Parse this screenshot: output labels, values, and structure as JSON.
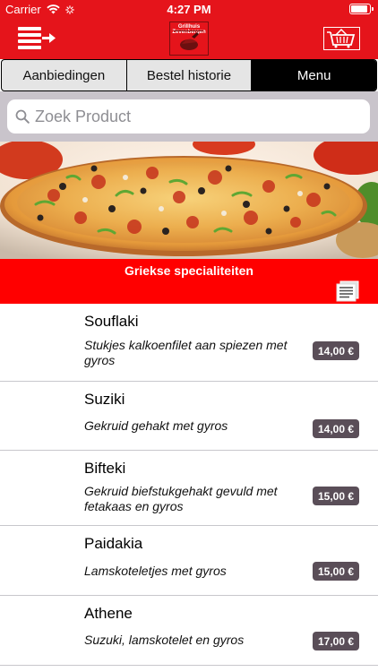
{
  "status_bar": {
    "carrier": "Carrier",
    "time": "4:27 PM",
    "battery_level": 1.0
  },
  "nav": {
    "logo_text": "Grillhuis Zevenbergen"
  },
  "tabs": [
    {
      "label": "Aanbiedingen",
      "active": false
    },
    {
      "label": "Bestel historie",
      "active": false
    },
    {
      "label": "Menu",
      "active": true
    }
  ],
  "search": {
    "placeholder": "Zoek Product",
    "value": ""
  },
  "category": {
    "title": "Griekse specialiteiten"
  },
  "products": [
    {
      "name": "Souflaki",
      "description": "Stukjes kalkoenfilet aan spiezen met gyros",
      "price": "14,00 €"
    },
    {
      "name": "Suziki",
      "description": "Gekruid gehakt met gyros",
      "price": "14,00 €"
    },
    {
      "name": "Bifteki",
      "description": "Gekruid biefstukgehakt gevuld met fetakaas en gyros",
      "price": "15,00 €"
    },
    {
      "name": "Paidakia",
      "description": "Lamskoteletjes met gyros",
      "price": "15,00 €"
    },
    {
      "name": "Athene",
      "description": "Suzuki, lamskotelet en gyros",
      "price": "17,00 €"
    }
  ],
  "colors": {
    "brand_red": "#e5141b",
    "category_red": "#ff0000",
    "price_badge": "#5a4e58",
    "search_bg": "#c9c4cb"
  },
  "icons": [
    "wifi-icon",
    "activity-icon",
    "battery-icon",
    "menu-arrow-icon",
    "logo-icon",
    "basket-icon",
    "search-icon",
    "document-list-icon"
  ]
}
